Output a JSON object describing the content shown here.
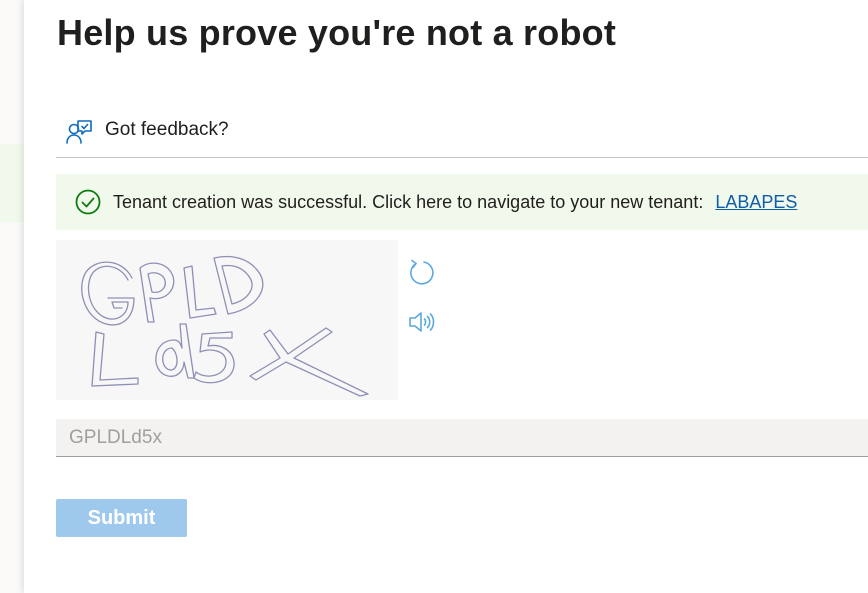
{
  "header": {
    "title": "Help us prove you're not a robot"
  },
  "feedback": {
    "label": "Got feedback?",
    "icon": "person-feedback-icon"
  },
  "banner": {
    "status": "success",
    "icon": "checkmark-circle-icon",
    "message": "Tenant creation was successful. Click here to navigate to your new tenant:",
    "link_text": "LABAPES",
    "color": "#f1f8ec",
    "link_color": "#0f5ea8"
  },
  "captcha": {
    "image_text": "GPLDLd5x",
    "refresh_icon": "refresh-icon",
    "audio_icon": "speaker-audio-icon",
    "input_value": "GPLDLd5x"
  },
  "form": {
    "submit_label": "Submit",
    "submit_color": "#9fc9ec"
  }
}
